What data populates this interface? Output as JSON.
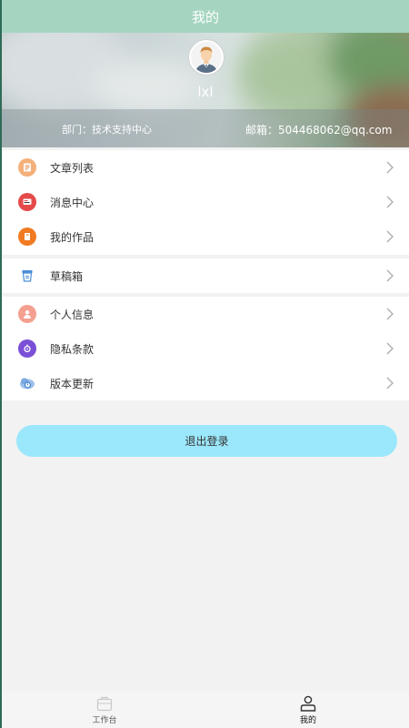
{
  "header": {
    "title": "我的"
  },
  "profile": {
    "username": "lxl",
    "department": "部门：技术支持中心",
    "email": "邮箱：504468062@qq.com"
  },
  "menu": {
    "group1": [
      {
        "label": "文章列表",
        "icon": "article-list-icon",
        "color": "#e8a46c"
      },
      {
        "label": "消息中心",
        "icon": "message-center-icon",
        "color": "#e54a4a"
      },
      {
        "label": "我的作品",
        "icon": "my-works-icon",
        "color": "#f07b22"
      }
    ],
    "group2": [
      {
        "label": "草稿箱",
        "icon": "drafts-icon",
        "color": "#4a8fd8"
      }
    ],
    "group3": [
      {
        "label": "个人信息",
        "icon": "personal-info-icon",
        "color": "#f08a7c"
      },
      {
        "label": "隐私条款",
        "icon": "privacy-terms-icon",
        "color": "#7b4fd6"
      },
      {
        "label": "版本更新",
        "icon": "version-update-icon",
        "color": "#3f7fd0"
      }
    ]
  },
  "logout": {
    "label": "退出登录"
  },
  "tabbar": {
    "workbench": "工作台",
    "mine": "我的"
  }
}
